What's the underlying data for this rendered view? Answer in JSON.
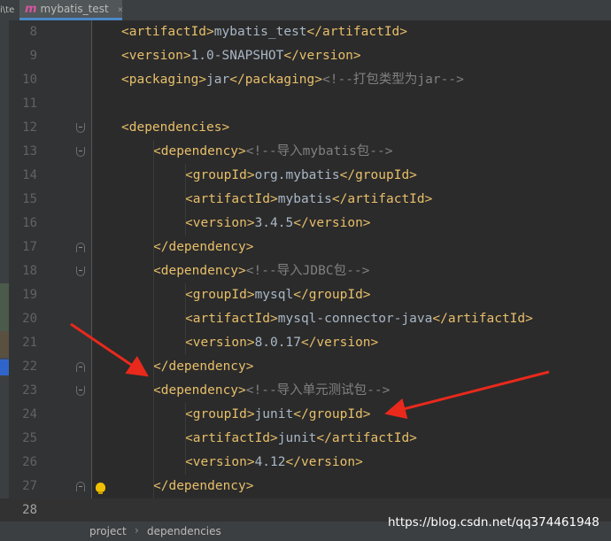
{
  "tab": {
    "left_peek": "i\\te",
    "icon": "m",
    "label": "mybatis_test",
    "close": "×"
  },
  "editor": {
    "lines": [
      {
        "num": "8",
        "indent": 0,
        "fold": null,
        "current": false,
        "segs": [
          [
            "tag",
            "<artifactId>"
          ],
          [
            "txt",
            "mybatis_test"
          ],
          [
            "tag",
            "</artifactId>"
          ]
        ]
      },
      {
        "num": "9",
        "indent": 0,
        "fold": null,
        "current": false,
        "segs": [
          [
            "tag",
            "<version>"
          ],
          [
            "txt",
            "1.0-SNAPSHOT"
          ],
          [
            "tag",
            "</version>"
          ]
        ]
      },
      {
        "num": "10",
        "indent": 0,
        "fold": null,
        "current": false,
        "segs": [
          [
            "tag",
            "<packaging>"
          ],
          [
            "txt",
            "jar"
          ],
          [
            "tag",
            "</packaging>"
          ],
          [
            "cmt",
            "<!--打包类型为jar-->"
          ]
        ]
      },
      {
        "num": "11",
        "indent": 0,
        "fold": null,
        "current": false,
        "segs": []
      },
      {
        "num": "12",
        "indent": 0,
        "fold": "open",
        "current": false,
        "segs": [
          [
            "tag",
            "<dependencies>"
          ]
        ]
      },
      {
        "num": "13",
        "indent": 1,
        "fold": "open",
        "current": false,
        "segs": [
          [
            "tag",
            "<dependency>"
          ],
          [
            "cmt",
            "<!--导入mybatis包-->"
          ]
        ]
      },
      {
        "num": "14",
        "indent": 2,
        "fold": null,
        "current": false,
        "segs": [
          [
            "tag",
            "<groupId>"
          ],
          [
            "txt",
            "org.mybatis"
          ],
          [
            "tag",
            "</groupId>"
          ]
        ]
      },
      {
        "num": "15",
        "indent": 2,
        "fold": null,
        "current": false,
        "segs": [
          [
            "tag",
            "<artifactId>"
          ],
          [
            "txt",
            "mybatis"
          ],
          [
            "tag",
            "</artifactId>"
          ]
        ]
      },
      {
        "num": "16",
        "indent": 2,
        "fold": null,
        "current": false,
        "segs": [
          [
            "tag",
            "<version>"
          ],
          [
            "txt",
            "3.4.5"
          ],
          [
            "tag",
            "</version>"
          ]
        ]
      },
      {
        "num": "17",
        "indent": 1,
        "fold": "close",
        "current": false,
        "segs": [
          [
            "tag",
            "</dependency>"
          ]
        ]
      },
      {
        "num": "18",
        "indent": 1,
        "fold": "open",
        "current": false,
        "segs": [
          [
            "tag",
            "<dependency>"
          ],
          [
            "cmt",
            "<!--导入JDBC包-->"
          ]
        ]
      },
      {
        "num": "19",
        "indent": 2,
        "fold": null,
        "current": false,
        "segs": [
          [
            "tag",
            "<groupId>"
          ],
          [
            "txt",
            "mysql"
          ],
          [
            "tag",
            "</groupId>"
          ]
        ]
      },
      {
        "num": "20",
        "indent": 2,
        "fold": null,
        "current": false,
        "segs": [
          [
            "tag",
            "<artifactId>"
          ],
          [
            "txt",
            "mysql-connector-java"
          ],
          [
            "tag",
            "</artifactId>"
          ]
        ]
      },
      {
        "num": "21",
        "indent": 2,
        "fold": null,
        "current": false,
        "segs": [
          [
            "tag",
            "<version>"
          ],
          [
            "txt",
            "8.0.17"
          ],
          [
            "tag",
            "</version>"
          ]
        ]
      },
      {
        "num": "22",
        "indent": 1,
        "fold": "close",
        "current": false,
        "segs": [
          [
            "tag",
            "</dependency>"
          ]
        ]
      },
      {
        "num": "23",
        "indent": 1,
        "fold": "open",
        "current": false,
        "segs": [
          [
            "tag",
            "<dependency>"
          ],
          [
            "cmt",
            "<!--导入单元测试包-->"
          ]
        ]
      },
      {
        "num": "24",
        "indent": 2,
        "fold": null,
        "current": false,
        "segs": [
          [
            "tag",
            "<groupId>"
          ],
          [
            "txt",
            "junit"
          ],
          [
            "tag",
            "</groupId>"
          ]
        ]
      },
      {
        "num": "25",
        "indent": 2,
        "fold": null,
        "current": false,
        "segs": [
          [
            "tag",
            "<artifactId>"
          ],
          [
            "txt",
            "junit"
          ],
          [
            "tag",
            "</artifactId>"
          ]
        ]
      },
      {
        "num": "26",
        "indent": 2,
        "fold": null,
        "current": false,
        "segs": [
          [
            "tag",
            "<version>"
          ],
          [
            "txt",
            "4.12"
          ],
          [
            "tag",
            "</version>"
          ]
        ]
      },
      {
        "num": "27",
        "indent": 1,
        "fold": "close",
        "current": false,
        "segs": [
          [
            "tag",
            "</dependency>"
          ]
        ]
      },
      {
        "num": "28",
        "indent": 0,
        "fold": null,
        "current": true,
        "segs": []
      }
    ]
  },
  "breadcrumb": {
    "project": "project",
    "separator": "›",
    "dependencies": "dependencies"
  },
  "watermark": "https://blog.csdn.net/qq374461948",
  "colors": {
    "tag": "#e8bf6a",
    "text": "#a9b7c6",
    "comment": "#808080",
    "arrow": "#e8291c"
  }
}
